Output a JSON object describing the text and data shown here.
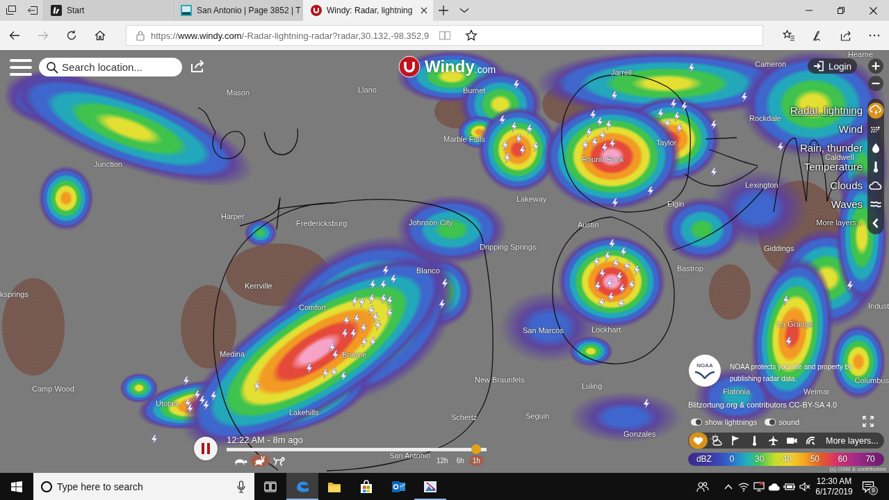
{
  "browser": {
    "tabs": [
      {
        "title": "Start",
        "kind": "start",
        "selected": false
      },
      {
        "title": "San Antonio | Page 3852 | T",
        "kind": "forum",
        "selected": false
      },
      {
        "title": "Windy: Radar, lightning",
        "kind": "windy",
        "selected": true
      }
    ],
    "nav": [
      {
        "kind": "back",
        "disabled": false
      },
      {
        "kind": "forward",
        "disabled": true
      },
      {
        "kind": "refresh",
        "disabled": false
      },
      {
        "kind": "home",
        "disabled": false
      }
    ],
    "address": {
      "url": "https://**www.windy.com**/-Radar-lightning-radar?radar,30.132,-98.352,9",
      "actions": [
        {
          "kind": "reading-view",
          "disabled": true
        },
        {
          "kind": "favorite",
          "disabled": false
        }
      ]
    }
  },
  "map": {
    "search": {
      "placeholder": "Search location..."
    },
    "logo": {
      "name": "Windy",
      "suffix": ".com"
    },
    "login": "Login",
    "layers": {
      "items": [
        {
          "label": "Radar, lightning",
          "kind": "radar",
          "selected": true
        },
        {
          "label": "Wind",
          "kind": "wind",
          "selected": false
        },
        {
          "label": "Rain, thunder",
          "kind": "rain",
          "selected": false
        },
        {
          "label": "Temperature",
          "kind": "temperature",
          "selected": false
        },
        {
          "label": "Clouds",
          "kind": "clouds",
          "selected": false
        },
        {
          "label": "Waves",
          "kind": "waves",
          "selected": false
        }
      ],
      "more": "More layers..."
    },
    "cities": [
      "Hearne",
      "Cameron",
      "Jarrell",
      "Mason",
      "Llano",
      "Burnet",
      "Rockdale",
      "Marble Falls",
      "Taylor",
      "Junction",
      "Round Rock",
      "Caldwell",
      "Lexington",
      "Lakeway",
      "Elgin",
      "Harper",
      "Fredericksburg",
      "Johnson City",
      "Austin",
      "Dripping Springs",
      "Giddings",
      "Blanco",
      "Bastrop",
      "Kerrville",
      "ksprings",
      "Comfort",
      "Indust",
      "San Marcos",
      "Lockhart",
      "La Grange",
      "Medina",
      "Boerne",
      "Camp Wood",
      "New Braunfels",
      "Luling",
      "Columbus",
      "Flatonia",
      "Weimar",
      "Utopia",
      "Lakehills",
      "Schertz",
      "Seguin",
      "Gonzales",
      "San Antonio"
    ],
    "timeline": {
      "playing": true,
      "time": "12:22 AM - 8m ago",
      "level": 0.96,
      "speeds": [
        {
          "kind": "turtle",
          "selected": false
        },
        {
          "kind": "rabbit",
          "selected": true
        },
        {
          "kind": "dog",
          "selected": false
        }
      ],
      "ranges": [
        {
          "label": "12h",
          "selected": false
        },
        {
          "label": "6h",
          "selected": false
        },
        {
          "label": "1h",
          "selected": true
        }
      ]
    },
    "noaa": {
      "logo": "NOAA",
      "text": "NOAA protects your life and property by publishing radar data."
    },
    "attribution": "Blitzortung.org & contributors CC-BY-SA 4.0",
    "toggles": [
      {
        "label": "show lightnings",
        "on": true
      },
      {
        "label": "sound",
        "on": true
      }
    ],
    "overlays": {
      "items": [
        {
          "kind": "favorites",
          "selected": true
        },
        {
          "kind": "weather",
          "selected": false
        },
        {
          "kind": "windsock",
          "selected": false
        },
        {
          "kind": "thermometer",
          "selected": false
        },
        {
          "kind": "plane",
          "selected": false
        },
        {
          "kind": "camera",
          "selected": false
        },
        {
          "kind": "radio",
          "selected": false
        }
      ],
      "more": "More layers..."
    },
    "legend": {
      "unit": "dBZ",
      "values": [
        "0",
        "30",
        "40",
        "50",
        "60",
        "70"
      ]
    },
    "copyright": "(c) OSM & contributors"
  },
  "taskbar": {
    "search": {
      "placeholder": "Type here to search"
    },
    "apps": [
      {
        "kind": "edge",
        "selected": true,
        "running": true
      },
      {
        "kind": "explorer",
        "selected": false,
        "running": false
      },
      {
        "kind": "store",
        "selected": false,
        "running": false
      },
      {
        "kind": "outlook",
        "selected": false,
        "running": false
      },
      {
        "kind": "paint",
        "selected": false,
        "running": true
      }
    ],
    "clock": {
      "time": "12:30 AM",
      "date": "6/17/2019"
    },
    "notifications": "9"
  }
}
